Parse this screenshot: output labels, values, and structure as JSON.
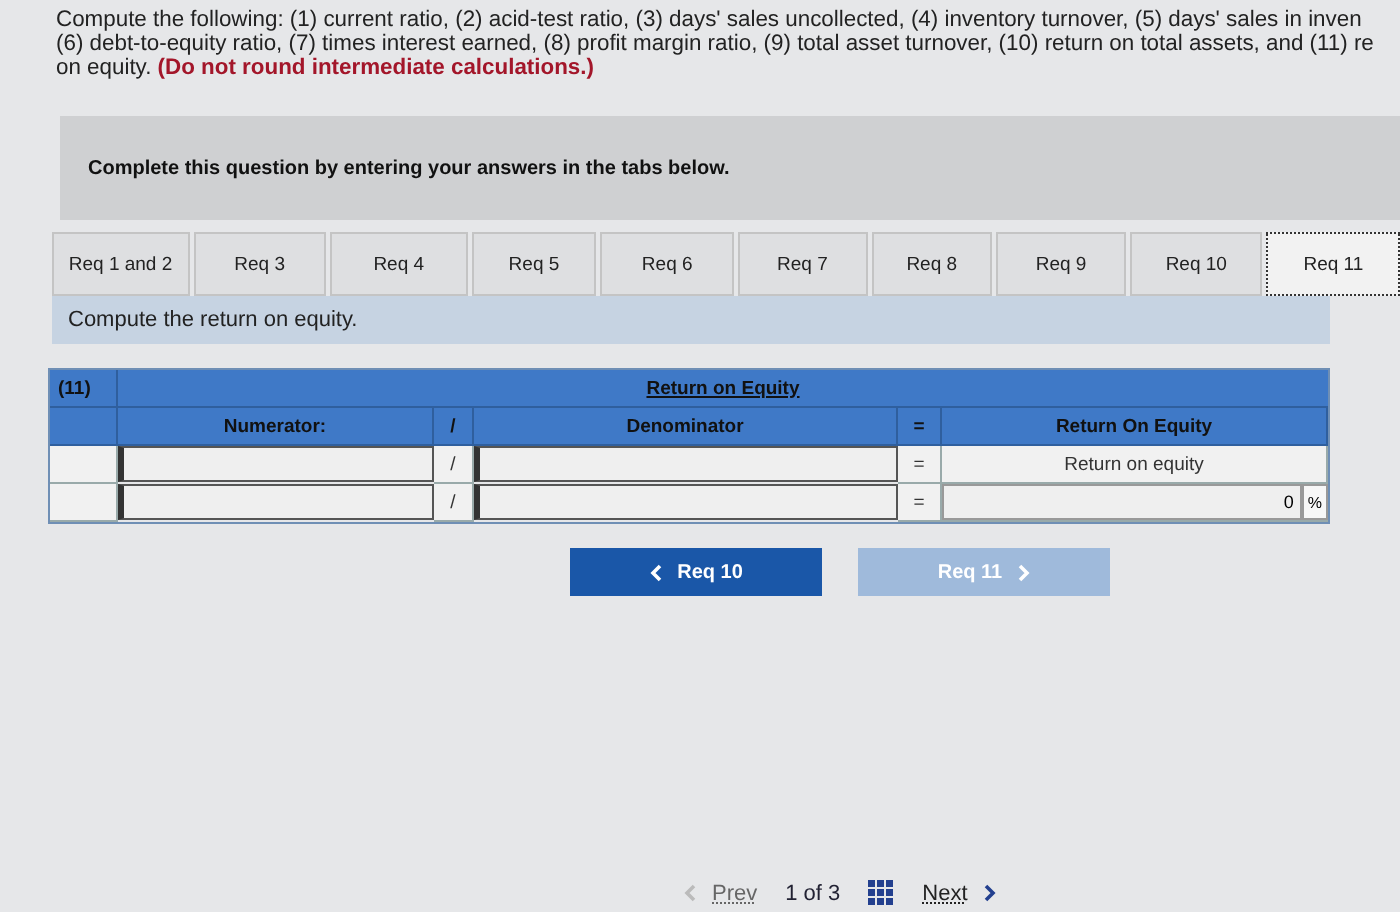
{
  "instructions": [
    "Compute the following: (1) current ratio, (2) acid-test ratio, (3) days' sales uncollected, (4) inventory turnover, (5) days' sales in inven",
    "(6) debt-to-equity ratio, (7) times interest earned, (8) profit margin ratio, (9) total asset turnover, (10) return on total assets, and (11) re",
    "on equity. **(Do not round intermediate calculations.)**"
  ],
  "prompt_banner": "Complete this question by entering your answers in the tabs below.",
  "tabs": [
    {
      "label": "Req 1 and 2",
      "selected": false
    },
    {
      "label": "Req 3",
      "selected": false
    },
    {
      "label": "Req 4",
      "selected": false
    },
    {
      "label": "Req 5",
      "selected": false
    },
    {
      "label": "Req 6",
      "selected": false
    },
    {
      "label": "Req 7",
      "selected": false
    },
    {
      "label": "Req 8",
      "selected": false
    },
    {
      "label": "Req 9",
      "selected": false
    },
    {
      "label": "Req 10",
      "selected": false
    },
    {
      "label": "Req 11",
      "selected": true
    }
  ],
  "task": "Compute the return on equity.",
  "table": {
    "number": "(11)",
    "title": "Return on Equity",
    "header": {
      "numerator": "Numerator:",
      "divide": "/",
      "denominator": "Denominator",
      "equals": "=",
      "result": "Return On Equity"
    },
    "rows": [
      {
        "numerator": "",
        "divide": "/",
        "denominator": "",
        "equals": "=",
        "result": "Return on equity",
        "kind": "label"
      },
      {
        "numerator": "",
        "divide": "/",
        "denominator": "",
        "equals": "=",
        "result": "0",
        "unit": "%",
        "kind": "input"
      }
    ]
  },
  "nav_buttons": [
    {
      "label": "Req 10",
      "kind": "prev",
      "disabled": false
    },
    {
      "label": "Req 11",
      "kind": "next",
      "disabled": true
    }
  ],
  "pager": {
    "prev": "Prev",
    "position": "1 of 3",
    "next": "Next",
    "prev_disabled": true
  }
}
